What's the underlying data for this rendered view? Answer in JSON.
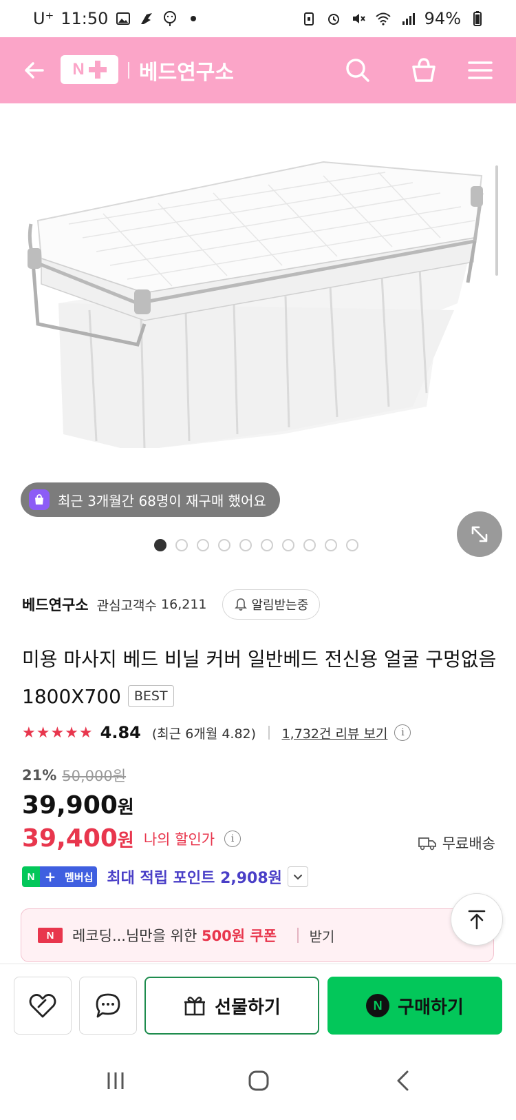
{
  "status_bar": {
    "carrier": "U⁺",
    "time": "11:50",
    "battery": "94%"
  },
  "header": {
    "logo_n": "N",
    "store_name": "베드연구소"
  },
  "product_image": {
    "repurchase_text": "최근 3개월간 68명이 재구매 했어요",
    "total_images": 10,
    "active_image": 1
  },
  "seller": {
    "name": "베드연구소",
    "interest_label": "관심고객수",
    "interest_count": "16,211",
    "alarm_label": "알림받는중"
  },
  "product": {
    "title": "미용 마사지 베드 비닐 커버 일반베드 전신용 얼굴 구멍없음 1800X700",
    "badge": "BEST",
    "stars": "★★★★★",
    "rating": "4.84",
    "recent_rating": "(최근 6개월 4.82)",
    "review_link": "1,732건 리뷰 보기",
    "discount_rate": "21%",
    "original_price": "50,000원",
    "sale_price": "39,900",
    "currency": "원",
    "my_price": "39,400",
    "my_price_label": "나의 할인가",
    "shipping": "무료배송"
  },
  "points": {
    "badge_n": "N",
    "badge_plus": "+",
    "badge_member": "멤버십",
    "text": "최대 적립 포인트 2,908원"
  },
  "coupon": {
    "logo": "N",
    "text_prefix": "레코딩...님만을 위한",
    "amount": "500원 쿠폰",
    "action": "받기"
  },
  "actions": {
    "gift_label": "선물하기",
    "buy_n": "N",
    "buy_label": "구매하기"
  },
  "colors": {
    "header_pink": "#fba5c8",
    "naver_green": "#03c75a",
    "price_red": "#e8364d",
    "membership_purple": "#4a3fc7"
  }
}
